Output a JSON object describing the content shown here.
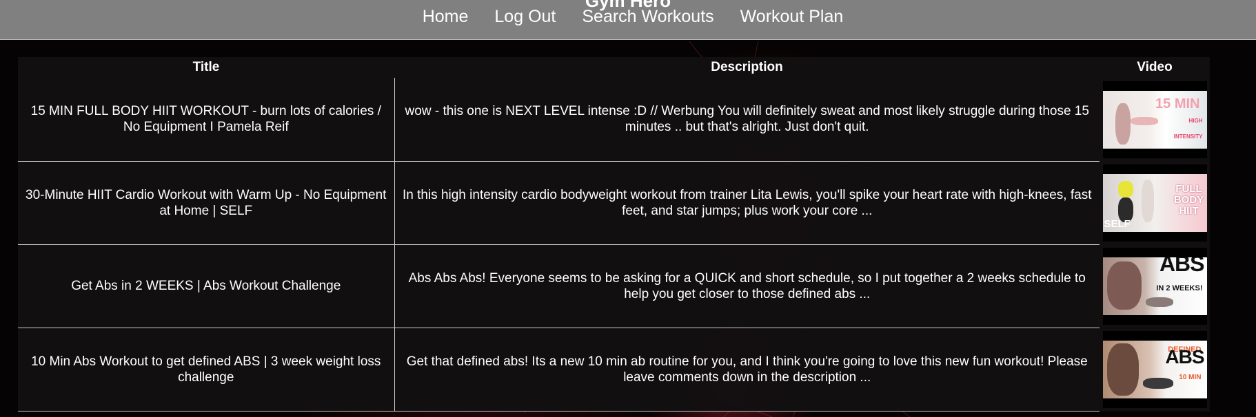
{
  "header": {
    "site_title": "Gym Hero",
    "nav": [
      {
        "label": "Home"
      },
      {
        "label": "Log Out"
      },
      {
        "label": "Search Workouts"
      },
      {
        "label": "Workout Plan"
      }
    ]
  },
  "table": {
    "columns": [
      "Title",
      "Description",
      "Video"
    ],
    "rows": [
      {
        "title": "15 MIN FULL BODY HIIT WORKOUT - burn lots of calories / No Equipment I Pamela Reif",
        "description": "wow - this one is NEXT LEVEL intense :D // Werbung You will definitely sweat and most likely struggle during those 15 minutes .. but that's alright. Just don't quit.",
        "thumb_main": "15 MIN",
        "thumb_sub": "HIGH INTENSITY FULL BODY"
      },
      {
        "title": "30-Minute HIIT Cardio Workout with Warm Up - No Equipment at Home | SELF",
        "description": "In this high intensity cardio bodyweight workout from trainer Lita Lewis, you'll spike your heart rate with high-knees, fast feet, and star jumps; plus work your core ...",
        "thumb_main": "FULL BODY HIIT",
        "thumb_sub": "SELF"
      },
      {
        "title": "Get Abs in 2 WEEKS | Abs Workout Challenge",
        "description": "Abs Abs Abs! Everyone seems to be asking for a QUICK and short schedule, so I put together a 2 weeks schedule to help you get closer to those defined abs ...",
        "thumb_main": "ABS",
        "thumb_sub": "IN 2 WEEKS!"
      },
      {
        "title": "10 Min Abs Workout to get defined ABS | 3 week weight loss challenge",
        "description": "Get that defined abs! Its a new 10 min ab routine for you, and I think you're going to love this new fun workout! Please leave comments down in the description ...",
        "thumb_main": "ABS",
        "thumb_sub": "DEFINED",
        "thumb_sub2": "10 MIN"
      }
    ]
  },
  "colors": {
    "header_bg": "#808080",
    "table_bg": "#121011",
    "text": "#ffffff",
    "thumb_accent": "#e8446a"
  }
}
